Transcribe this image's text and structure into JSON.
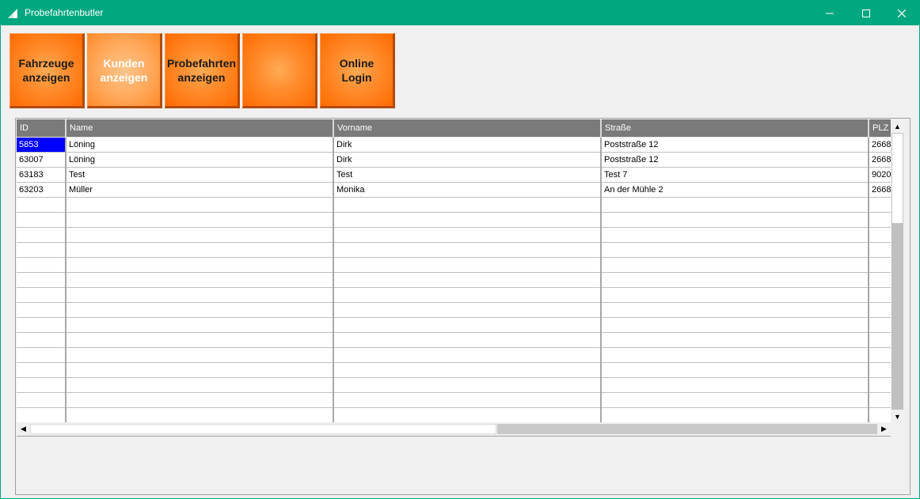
{
  "window": {
    "title": "Probefahrtenbutler",
    "minimize_icon": "minimize-icon",
    "maximize_icon": "maximize-icon",
    "close_icon": "close-icon",
    "accent": "#00a77f"
  },
  "toolbar": {
    "buttons": [
      {
        "line1": "Fahrzeuge",
        "line2": "anzeigen"
      },
      {
        "line1": "Kunden",
        "line2": "anzeigen"
      },
      {
        "line1": "Probefahrten",
        "line2": "anzeigen"
      },
      {
        "line1": "",
        "line2": ""
      },
      {
        "line1": "Online",
        "line2": "Login"
      }
    ],
    "color": "#ff7a1a"
  },
  "grid": {
    "columns": [
      "ID",
      "Name",
      "Vorname",
      "Straße",
      "PLZ"
    ],
    "rows": [
      {
        "id": "5853",
        "name": "Löning",
        "vorname": "Dirk",
        "strasse": "Poststraße 12",
        "plz": "2668"
      },
      {
        "id": "63007",
        "name": "Löning",
        "vorname": "Dirk",
        "strasse": "Poststraße 12",
        "plz": "2668"
      },
      {
        "id": "63183",
        "name": "Test",
        "vorname": "Test",
        "strasse": "Test 7",
        "plz": "9020"
      },
      {
        "id": "63203",
        "name": "Müller",
        "vorname": "Monika",
        "strasse": "An der Mühle 2",
        "plz": "2668"
      }
    ],
    "selected_cell_color": "#0000ff"
  }
}
